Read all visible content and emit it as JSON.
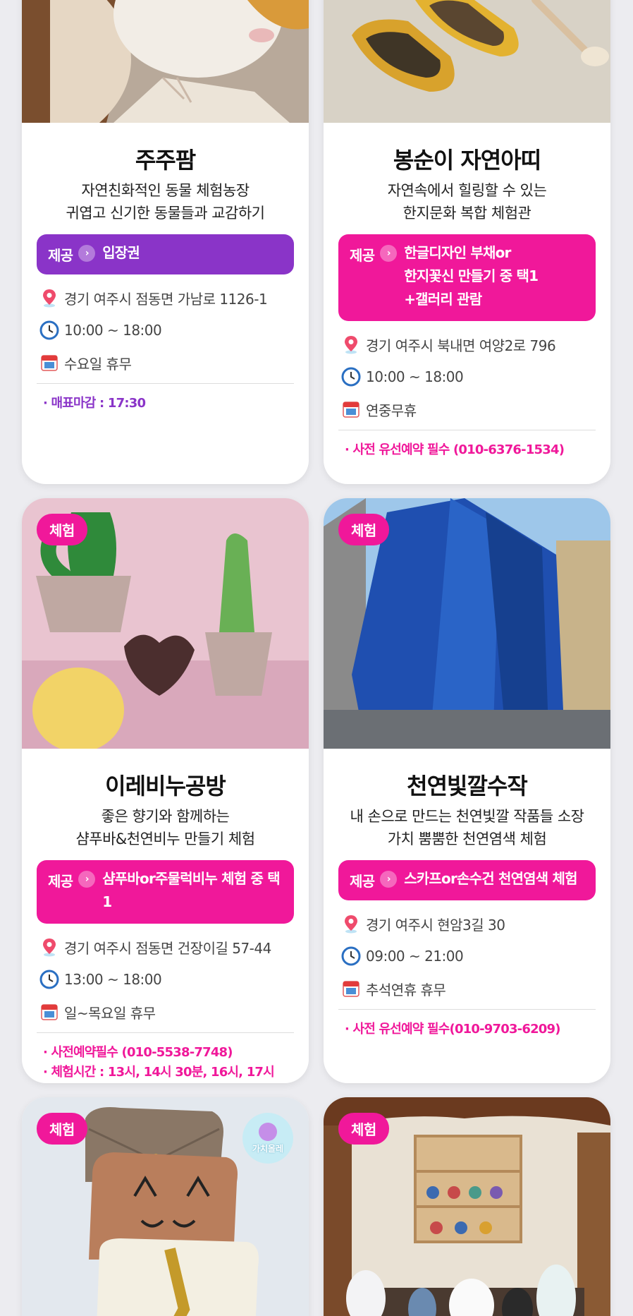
{
  "colors": {
    "pink": "#f0189a",
    "purple": "#8a34c8"
  },
  "cards": [
    {
      "title": "주주팜",
      "desc1": "자연친화적인 동물 체험농장",
      "desc2": "귀엽고 신기한 동물들과 교감하기",
      "provide_label": "제공",
      "provide_lines": [
        "입장권"
      ],
      "address": "경기 여주시 점동면 가남로 1126-1",
      "hours": "10:00 ~ 18:00",
      "closed": "수요일 휴무",
      "notes": [
        "· 매표마감 : 17:30"
      ]
    },
    {
      "title": "봉순이 자연아띠",
      "desc1": "자연속에서 힐링할 수 있는",
      "desc2": "한지문화 복합 체험관",
      "provide_label": "제공",
      "provide_lines": [
        "한글디자인 부채or",
        "한지꽃신 만들기 중 택1",
        "+갤러리 관람"
      ],
      "address": "경기 여주시 북내면 여양2로 796",
      "hours": "10:00 ~ 18:00",
      "closed": "연중무휴",
      "notes": [
        "· 사전 유선예약 필수 (010-6376-1534)"
      ]
    },
    {
      "tag": "체험",
      "title": "이레비누공방",
      "desc1": "좋은 향기와 함께하는",
      "desc2": "샴푸바&천연비누 만들기 체험",
      "provide_label": "제공",
      "provide_lines": [
        "샴푸바or주물럭비누 체험 중 택1"
      ],
      "address": "경기 여주시 점동면 건장이길 57-44",
      "hours": "13:00 ~ 18:00",
      "closed": "일~목요일 휴무",
      "notes": [
        "· 사전예약필수 (010-5538-7748)",
        "· 체험시간 : 13시, 14시 30분, 16시, 17시"
      ]
    },
    {
      "tag": "체험",
      "title": "천연빛깔수작",
      "desc1": "내 손으로 만드는 천연빛깔 작품들 소장",
      "desc2": "가치 뿜뿜한 천연염색 체험",
      "provide_label": "제공",
      "provide_lines": [
        "스카프or손수건 천연염색 체험"
      ],
      "address": "경기 여주시 현암3길 30",
      "hours": "09:00 ~ 21:00",
      "closed": "추석연휴 휴무",
      "notes": [
        "· 사전 유선예약 필수(010-9703-6209)"
      ]
    },
    {
      "tag": "체험",
      "badge": "가치올레"
    },
    {
      "tag": "체험"
    }
  ],
  "icons": {
    "location": "location-pin-icon",
    "clock": "clock-icon",
    "calendar": "calendar-icon",
    "arrow": "chevron-right-icon"
  }
}
